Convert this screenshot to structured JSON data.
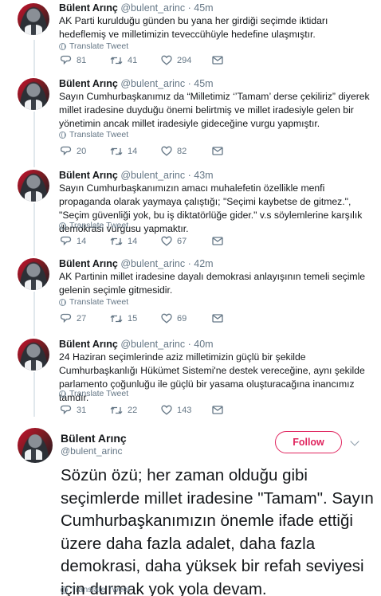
{
  "thread": [
    {
      "name": "Bülent Arınç",
      "handle": "@bulent_arinc",
      "separator": "·",
      "time": "45m",
      "text": "AK Parti kurulduğu günden bu yana her girdiği seçimde iktidarı hedeflemiş ve milletimizin teveccühüyle hedefine ulaşmıştır.",
      "translate": "Translate Tweet",
      "replies": "81",
      "retweets": "41",
      "likes": "294"
    },
    {
      "name": "Bülent Arınç",
      "handle": "@bulent_arinc",
      "separator": "·",
      "time": "45m",
      "text": "Sayın Cumhurbaşkanımız da “Milletimiz ‘’Tamam’ derse çekiliriz” diyerek millet iradesine duyduğu önemi belirtmiş ve millet iradesiyle gelen bir yönetimin ancak millet iradesiyle gideceğine vurgu yapmıştır.",
      "translate": "Translate Tweet",
      "replies": "20",
      "retweets": "14",
      "likes": "82"
    },
    {
      "name": "Bülent Arınç",
      "handle": "@bulent_arinc",
      "separator": "·",
      "time": "43m",
      "text": "Sayın Cumhurbaşkanımızın amacı muhalefetin özellikle menfi propaganda olarak yaymaya çalıştığı; \"Seçimi kaybetse de gitmez.\", \"Seçim güvenliği yok, bu iş diktatörlüğe gider.\" v.s söylemlerine karşılık demokrasi vurgusu yapmaktır.",
      "translate": "Translate Tweet",
      "replies": "14",
      "retweets": "14",
      "likes": "67"
    },
    {
      "name": "Bülent Arınç",
      "handle": "@bulent_arinc",
      "separator": "·",
      "time": "42m",
      "text": "AK Partinin millet iradesine dayalı demokrasi anlayışının temeli seçimle gelenin seçimle gitmesidir.",
      "translate": "Translate Tweet",
      "replies": "27",
      "retweets": "15",
      "likes": "69"
    },
    {
      "name": "Bülent Arınç",
      "handle": "@bulent_arinc",
      "separator": "·",
      "time": "40m",
      "text": "24 Haziran seçimlerinde aziz milletimizin güçlü bir şekilde Cumhurbaşkanlığı Hükümet Sistemi'ne destek vereceğine, aynı şekilde parlamento çoğunluğu ile güçlü bir yasama oluşturacağına inancımız tamdır.",
      "translate": "Translate Tweet",
      "replies": "31",
      "retweets": "22",
      "likes": "143"
    }
  ],
  "main": {
    "name": "Bülent Arınç",
    "handle": "@bulent_arinc",
    "follow_label": "Follow",
    "text": "Sözün özü; her zaman olduğu gibi seçimlerde millet iradesine \"Tamam\". Sayın Cumhurbaşkanımızın önemle ifade ettiği üzere daha fazla adalet, daha fazla demokrasi, daha yüksek bir refah seviyesi için durmak yok yola devam.",
    "translate": "Translate Tweet"
  },
  "colors": {
    "accent": "#e0245e",
    "muted": "#657786",
    "thread_line": "#e1e8ed"
  },
  "icons": [
    "reply-icon",
    "retweet-icon",
    "like-icon",
    "message-icon",
    "globe-icon",
    "chevron-down-icon"
  ]
}
